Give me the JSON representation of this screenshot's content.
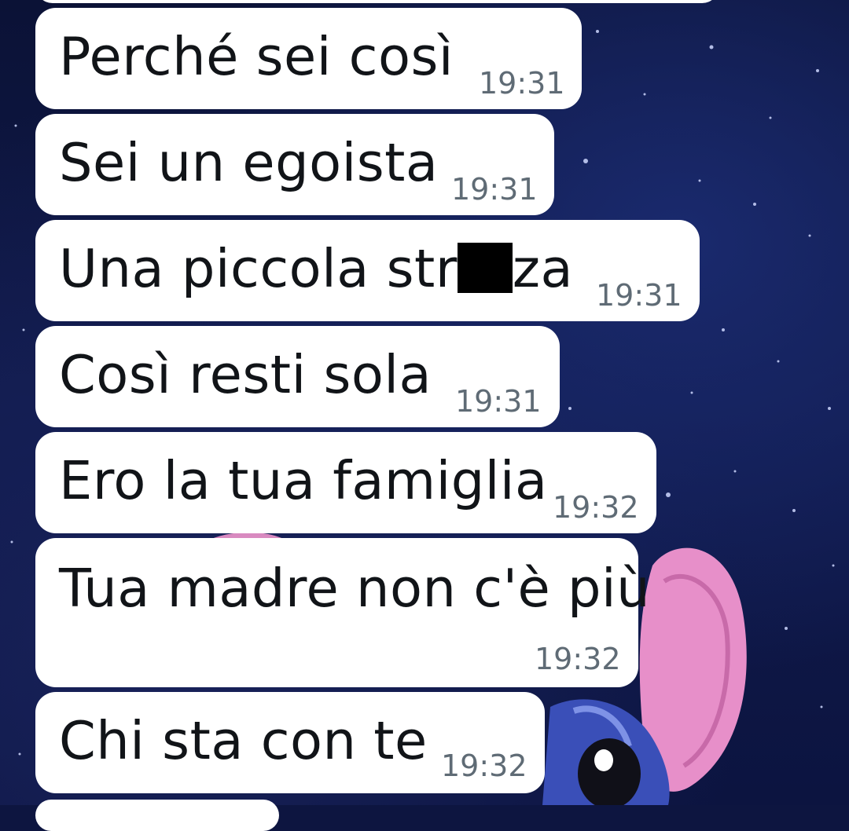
{
  "chat": {
    "messages": [
      {
        "text": "Perché sei così",
        "time": "19:31"
      },
      {
        "text": "Sei un egoista",
        "time": "19:31"
      },
      {
        "text_before": "Una piccola str",
        "text_after": "za",
        "time": "19:31"
      },
      {
        "text": "Così resti sola",
        "time": "19:31"
      },
      {
        "text": "Ero la tua famiglia",
        "time": "19:32"
      },
      {
        "text": "Tua madre non c'è più",
        "time": "19:32"
      },
      {
        "text": "Chi sta con te",
        "time": "19:32"
      }
    ]
  },
  "colors": {
    "bubble": "#ffffff",
    "text": "#111418",
    "timestamp": "#5f6b75",
    "wallpaper": "#0d1540",
    "stitch_ear_pink": "#e78fc9",
    "stitch_blue": "#3a4fb8"
  },
  "icons": {
    "wallpaper": "stitch-galaxy-wallpaper-icon",
    "redaction": "censor-block-icon"
  }
}
